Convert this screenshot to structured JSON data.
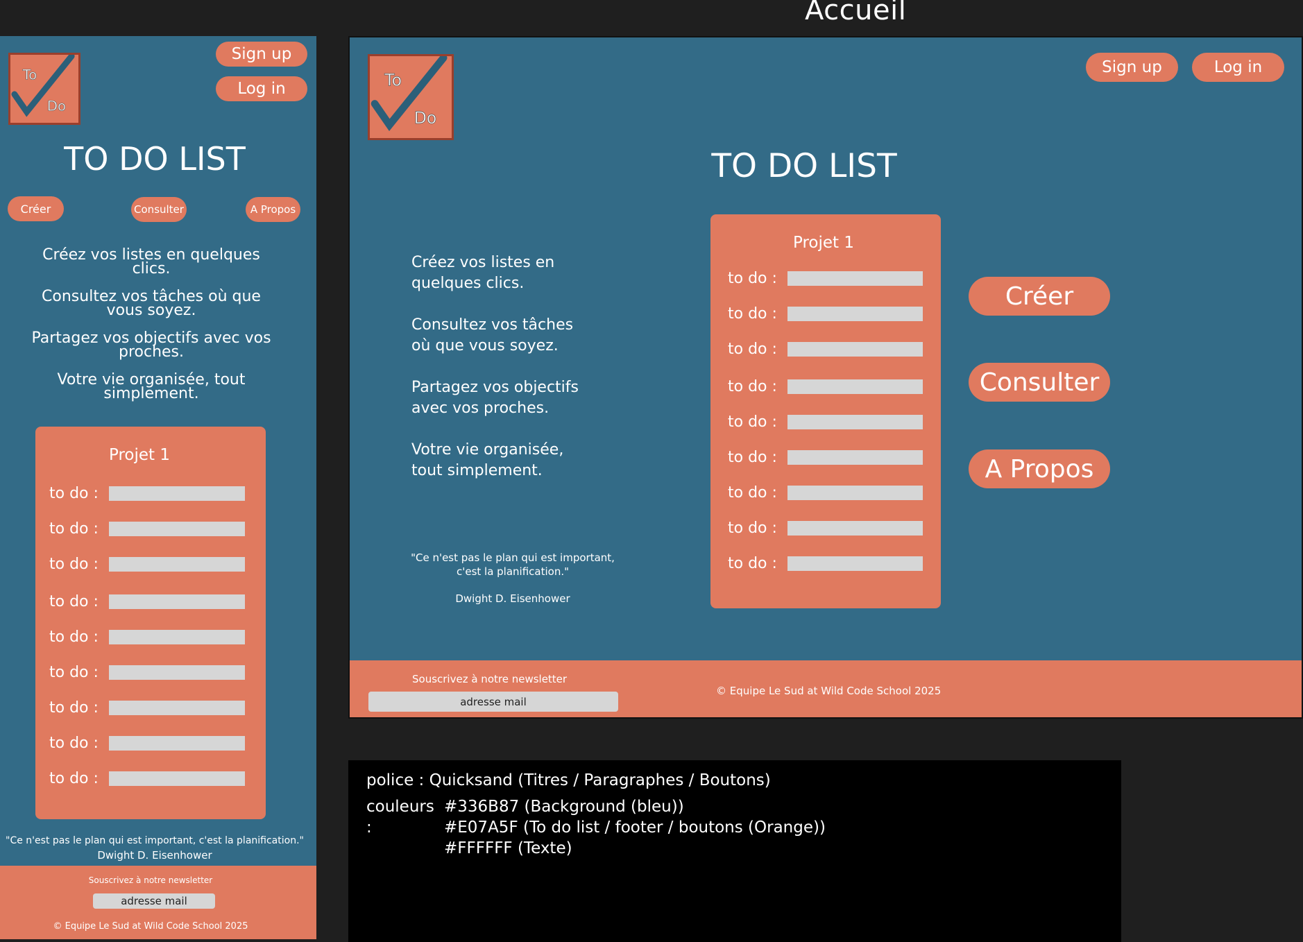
{
  "page_title": "Accueil",
  "logo": {
    "top_text": "To",
    "bottom_text": "Do"
  },
  "nav": {
    "signup": "Sign up",
    "login": "Log in"
  },
  "app_title": "TO DO LIST",
  "menu": {
    "create": "Créer",
    "consult": "Consulter",
    "about": "A Propos"
  },
  "mobile_intro": [
    "Créez vos listes en quelques clics.",
    "Consultez vos tâches où que vous soyez.",
    "Partagez vos objectifs avec vos proches.",
    "Votre vie organisée, tout simplement."
  ],
  "desktop_intro": [
    "Créez vos listes en quelques clics.",
    "Consultez vos tâches où que vous soyez.",
    "Partagez vos objectifs avec vos proches.",
    "Votre vie organisée, tout simplement."
  ],
  "project": {
    "title": "Projet 1",
    "todos": [
      "to do :",
      "to do :",
      "to do :",
      "to do :",
      "to do :",
      "to do :",
      "to do :",
      "to do :",
      "to do :"
    ]
  },
  "quote": {
    "text_mobile": "\"Ce n'est pas le plan qui est important, c'est la planification.\"",
    "text_line1": "\"Ce n'est pas le plan qui est important,",
    "text_line2": "c'est la planification.\"",
    "author": "Dwight D. Eisenhower"
  },
  "footer": {
    "newsletter_label": "Souscrivez à notre newsletter",
    "email_placeholder": "adresse mail",
    "copyright": "© Equipe Le Sud at Wild Code School 2025"
  },
  "style_guide": {
    "font_line": "police : Quicksand (Titres / Paragraphes / Boutons)",
    "colors_label": "couleurs :",
    "color_1": "#336B87 (Background (bleu))",
    "color_2": "#E07A5F (To do list / footer / boutons (Orange))",
    "color_3": "#FFFFFF (Texte)"
  },
  "colors": {
    "background_blue": "#336B87",
    "accent_orange": "#E07A5F",
    "text_white": "#FFFFFF",
    "input_gray": "#D6D6D6"
  }
}
